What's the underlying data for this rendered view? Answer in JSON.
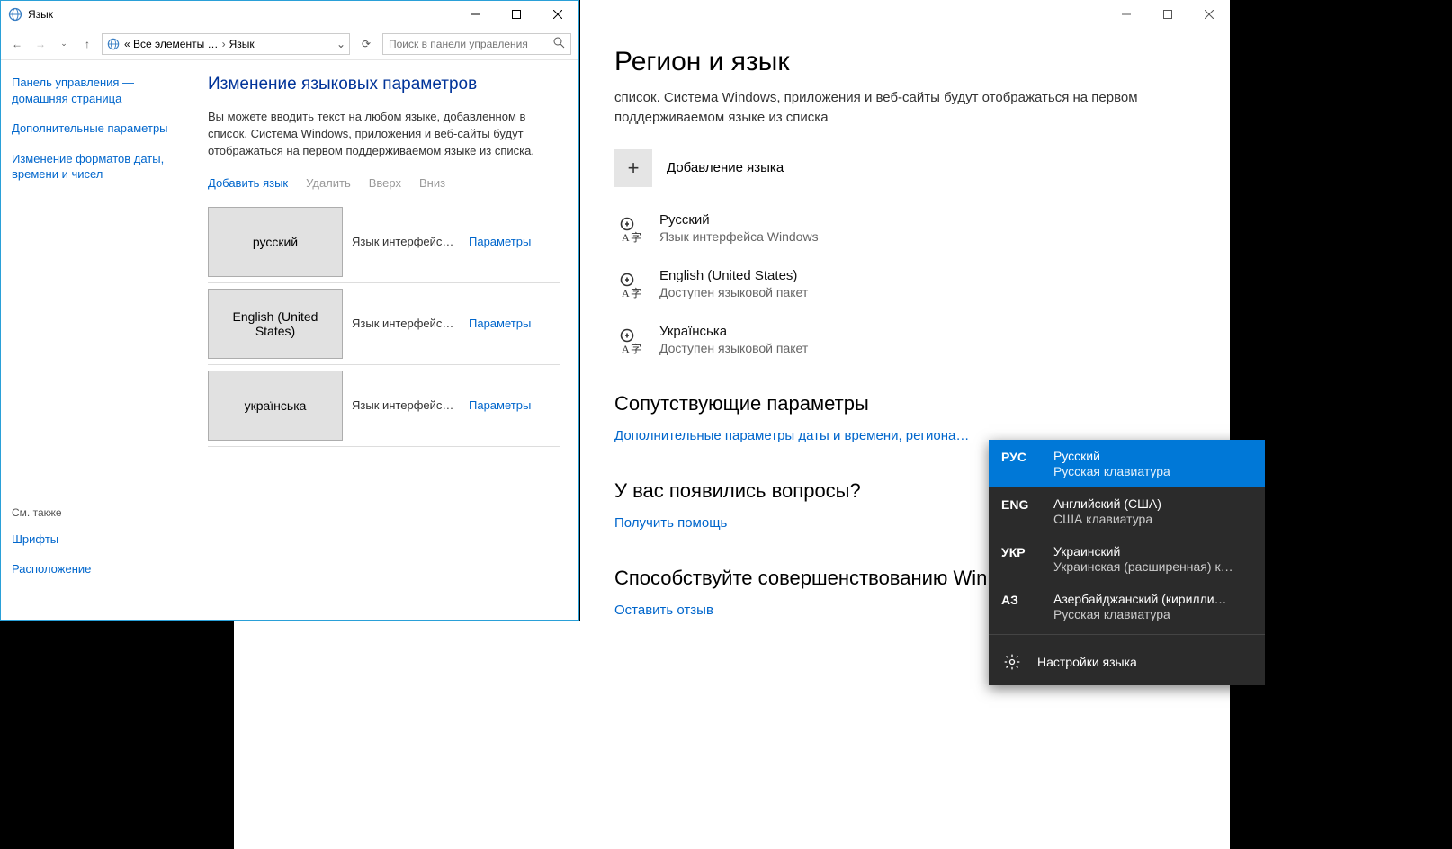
{
  "cp": {
    "title": "Язык",
    "breadcrumb_prefix": "« Все элементы …",
    "breadcrumb_current": "Язык",
    "search_placeholder": "Поиск в панели управления",
    "sidebar": {
      "home": "Панель управления — домашняя страница",
      "advanced": "Дополнительные параметры",
      "formats": "Изменение форматов даты, времени и чисел",
      "seealso_label": "См. также",
      "fonts": "Шрифты",
      "location": "Расположение"
    },
    "main": {
      "heading": "Изменение языковых параметров",
      "description": "Вы можете вводить текст на любом языке, добавленном в список. Система Windows, приложения и веб-сайты будут отображаться на первом поддерживаемом языке из списка.",
      "toolbar": {
        "add": "Добавить язык",
        "remove": "Удалить",
        "up": "Вверх",
        "down": "Вниз"
      },
      "langs": [
        {
          "name": "русский",
          "desc": "Язык интерфейса …",
          "params": "Параметры"
        },
        {
          "name": "English (United States)",
          "desc": "Язык интерфейса …",
          "params": "Параметры"
        },
        {
          "name": "українська",
          "desc": "Язык интерфейса …",
          "params": "Параметры"
        }
      ]
    }
  },
  "settings": {
    "heading": "Регион и язык",
    "description": "список. Система Windows, приложения и веб-сайты будут отображаться на первом поддерживаемом языке из списка",
    "add_label": "Добавление языка",
    "langs": [
      {
        "name": "Русский",
        "sub": "Язык интерфейса Windows"
      },
      {
        "name": "English (United States)",
        "sub": "Доступен языковой пакет"
      },
      {
        "name": "Українська",
        "sub": "Доступен языковой пакет"
      }
    ],
    "related_heading": "Сопутствующие параметры",
    "related_link": "Дополнительные параметры даты и времени, региона…",
    "help_heading": "У вас появились вопросы?",
    "help_link": "Получить помощь",
    "feedback_heading": "Способствуйте совершенствованию Win…",
    "feedback_link": "Оставить отзыв"
  },
  "flyout": {
    "items": [
      {
        "code": "РУС",
        "name": "Русский",
        "kbd": "Русская клавиатура",
        "selected": true
      },
      {
        "code": "ENG",
        "name": "Английский (США)",
        "kbd": "США клавиатура",
        "selected": false
      },
      {
        "code": "УКР",
        "name": "Украинский",
        "kbd": "Украинская (расширенная) к…",
        "selected": false
      },
      {
        "code": "АЗ",
        "name": "Азербайджанский (кирилли…",
        "kbd": "Русская клавиатура",
        "selected": false
      }
    ],
    "settings_label": "Настройки языка"
  }
}
